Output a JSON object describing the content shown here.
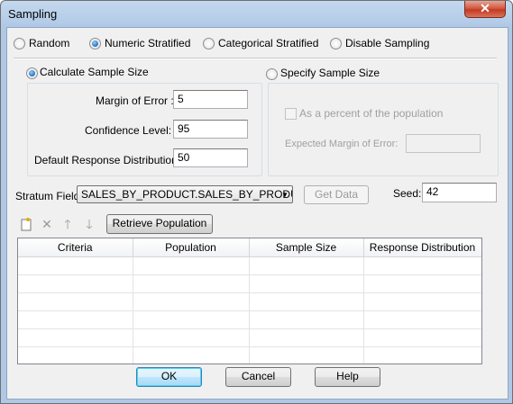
{
  "window": {
    "title": "Sampling",
    "close_glyph": "✕"
  },
  "mode_options": [
    {
      "label": "Random",
      "checked": false
    },
    {
      "label": "Numeric Stratified",
      "checked": true
    },
    {
      "label": "Categorical Stratified",
      "checked": false
    },
    {
      "label": "Disable Sampling",
      "checked": false
    }
  ],
  "calculate": {
    "label": "Calculate Sample Size",
    "checked": true,
    "margin_of_error_label": "Margin of Error :",
    "margin_of_error_value": "5",
    "confidence_label": "Confidence Level:",
    "confidence_value": "95",
    "response_label": "Default Response Distribution:",
    "response_value": "50"
  },
  "specify": {
    "label": "Specify Sample Size",
    "checked": false,
    "percent_label": "As a percent of the population",
    "expected_label": "Expected Margin of Error:",
    "expected_value": ""
  },
  "stratum": {
    "label": "Stratum Field:",
    "value": "SALES_BY_PRODUCT.SALES_BY_PRODU",
    "get_data_label": "Get Data",
    "seed_label": "Seed:",
    "seed_value": "42"
  },
  "toolbar": {
    "new_icon": "new-row-icon",
    "delete_icon": "delete-icon",
    "up_icon": "move-up-icon",
    "down_icon": "move-down-icon",
    "retrieve_label": "Retrieve Population"
  },
  "grid": {
    "columns": [
      "Criteria",
      "Population",
      "Sample Size",
      "Response Distribution"
    ],
    "rows": [
      [
        "",
        "",
        "",
        ""
      ],
      [
        "",
        "",
        "",
        ""
      ],
      [
        "",
        "",
        "",
        ""
      ],
      [
        "",
        "",
        "",
        ""
      ],
      [
        "",
        "",
        "",
        ""
      ],
      [
        "",
        "",
        "",
        ""
      ]
    ]
  },
  "footer": {
    "ok_label": "OK",
    "cancel_label": "Cancel",
    "help_label": "Help"
  },
  "colors": {
    "accent_radio": "#1f6ec3",
    "title_bar": "#b6cde8",
    "close_button": "#c43a20"
  }
}
